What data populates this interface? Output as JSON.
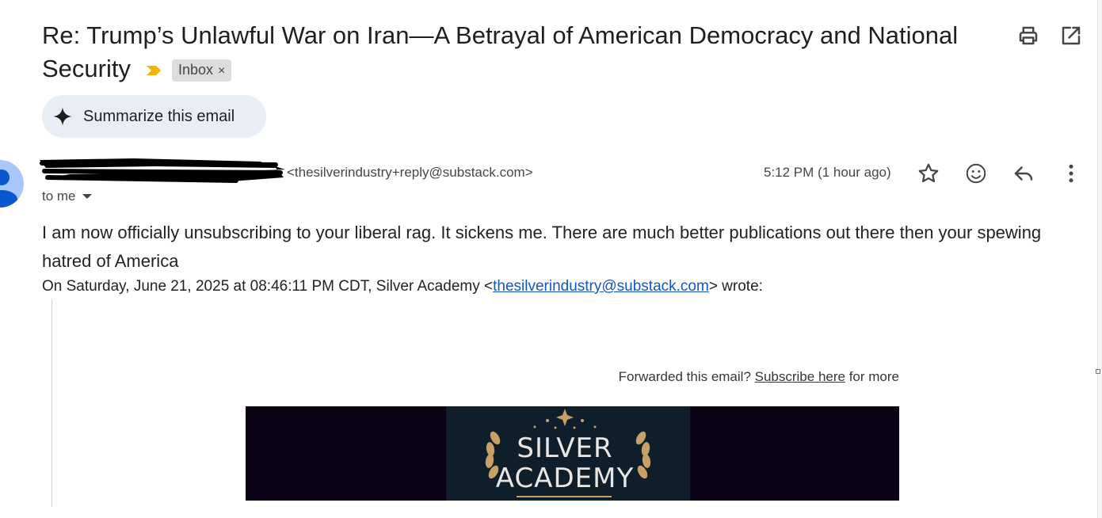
{
  "email": {
    "subject": "Re: Trump’s Unlawful War on Iran—A Betrayal of American Democracy and National Security",
    "label_chip": "Inbox",
    "label_remove": "×",
    "summarize_label": "Summarize this email",
    "sender_email": "<thesilverindustry+reply@substack.com>",
    "recipient": "to me",
    "timestamp": "5:12 PM (1 hour ago)",
    "body": "I am now officially unsubscribing to your liberal rag. It sickens me. There are much better publications out there then your spewing hatred of America",
    "quote_header_prefix": "On Saturday, June 21, 2025 at 08:46:11 PM CDT, Silver Academy <",
    "quote_header_link": "thesilverindustry@substack.com",
    "quote_header_suffix": "> wrote:",
    "forwarded_prefix": "Forwarded this email? ",
    "forwarded_link": "Subscribe here",
    "forwarded_suffix": " for more",
    "logo_line1": "SILVER",
    "logo_line2": "ACADEMY"
  },
  "icons": {
    "print": "print-icon",
    "open_new": "open-in-new-window-icon",
    "star": "star-icon",
    "emoji": "emoji-reaction-icon",
    "reply": "reply-icon",
    "more": "more-vert-icon",
    "important": "importance-marker-icon",
    "sparkle": "sparkle-icon"
  },
  "colors": {
    "importance_marker": "#f4b400",
    "summarize_bg": "#e9eef6",
    "link": "#1155cc",
    "banner_bg": "#0c0416",
    "logo_gold": "#c9a063"
  }
}
